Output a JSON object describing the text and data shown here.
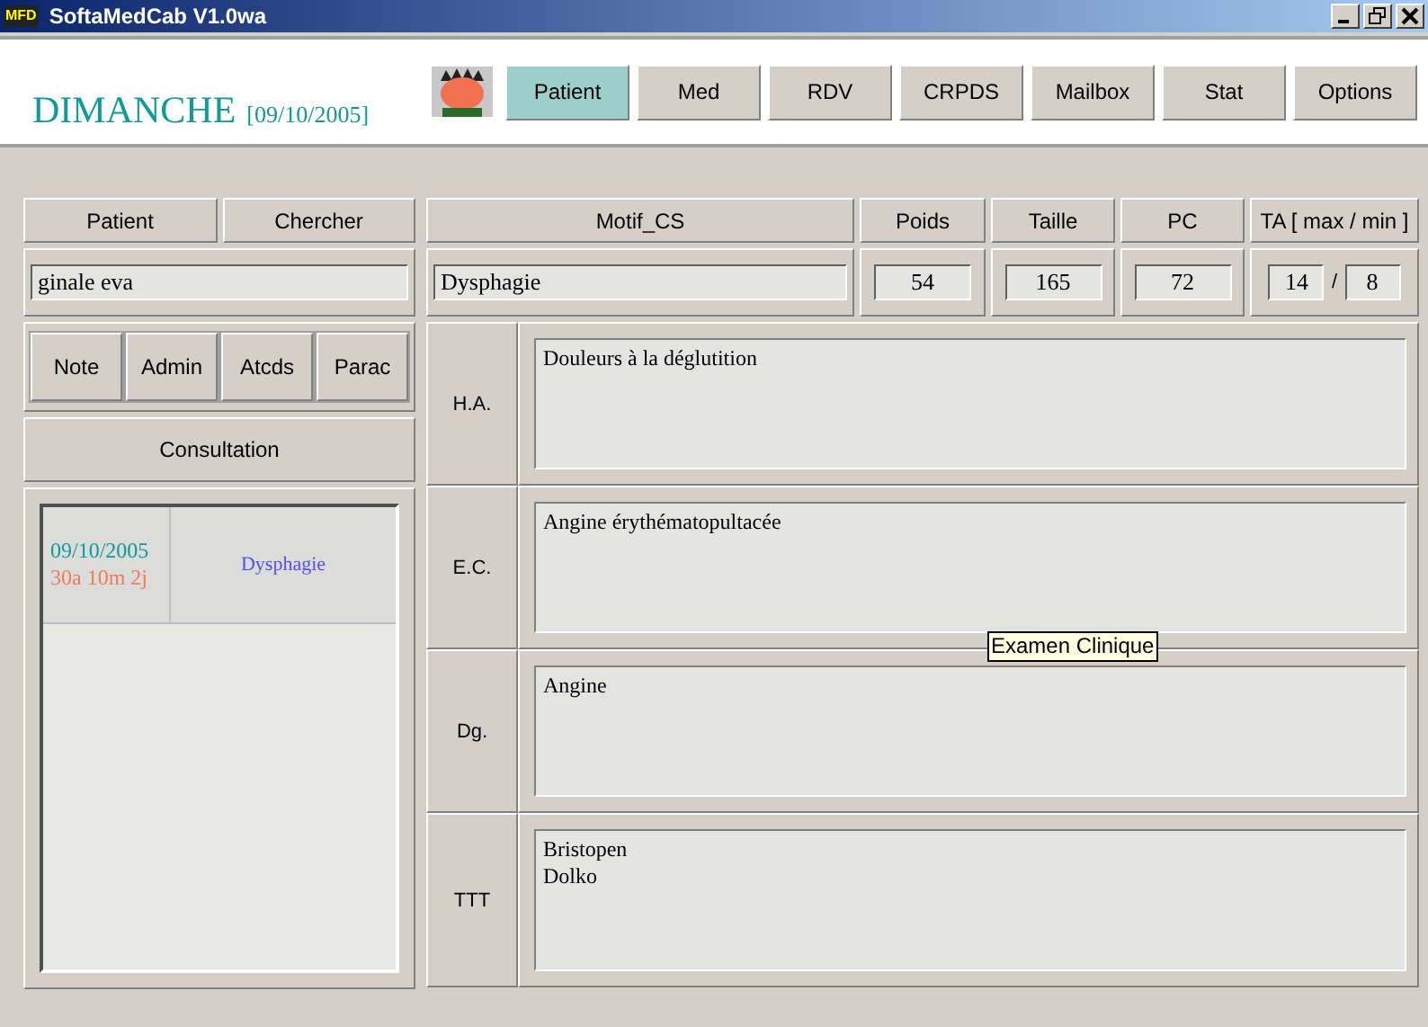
{
  "window": {
    "title": "SoftaMedCab V1.0wa",
    "icon_label": "MFD"
  },
  "header": {
    "day": "DIMANCHE",
    "date": "[09/10/2005]"
  },
  "nav": [
    {
      "label": "Patient",
      "selected": true
    },
    {
      "label": "Med",
      "selected": false
    },
    {
      "label": "RDV",
      "selected": false
    },
    {
      "label": "CRPDS",
      "selected": false
    },
    {
      "label": "Mailbox",
      "selected": false
    },
    {
      "label": "Stat",
      "selected": false
    },
    {
      "label": "Options",
      "selected": false
    }
  ],
  "patient": {
    "headers": [
      "Patient",
      "Chercher"
    ],
    "name": "ginale eva"
  },
  "left_buttons": [
    "Note",
    "Admin",
    "Atcds",
    "Parac"
  ],
  "consultation": {
    "label": "Consultation",
    "rows": [
      {
        "date": "09/10/2005",
        "age": "30a 10m 2j",
        "motif": "Dysphagie"
      }
    ]
  },
  "vitals": {
    "motif_label": "Motif_CS",
    "motif": "Dysphagie",
    "fields": [
      {
        "label": "Poids",
        "value": "54"
      },
      {
        "label": "Taille",
        "value": "165"
      },
      {
        "label": "PC",
        "value": "72"
      }
    ],
    "ta_label": "TA [ max / min ]",
    "ta_max": "14",
    "ta_sep": "/",
    "ta_min": "8"
  },
  "sections": [
    {
      "label": "H.A.",
      "text": "Douleurs à la déglutition"
    },
    {
      "label": "E.C.",
      "text": "Angine érythématopultacée"
    },
    {
      "label": "Dg.",
      "text": "Angine"
    },
    {
      "label": "TTT",
      "text": "Bristopen\nDolko"
    }
  ],
  "tooltip": "Examen Clinique"
}
